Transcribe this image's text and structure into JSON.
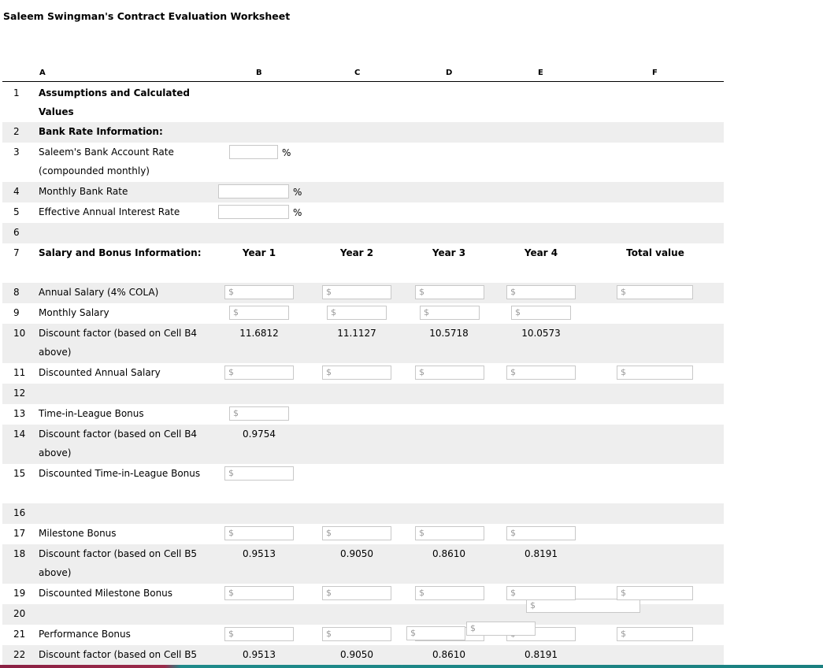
{
  "title": "Saleem Swingman's Contract Evaluation Worksheet",
  "columns": [
    "A",
    "B",
    "C",
    "D",
    "E",
    "F"
  ],
  "currency_placeholder": "$",
  "percent_sign": "%",
  "rows": {
    "r1": "Assumptions and Calculated Values",
    "r2": "Bank Rate Information:",
    "r3": "Saleem's Bank Account Rate (compounded monthly)",
    "r4": "Monthly Bank Rate",
    "r5": "Effective Annual Interest Rate",
    "r7": "Salary and Bonus Information:",
    "r8": "Annual Salary (4% COLA)",
    "r9": "Monthly Salary",
    "r10": "Discount factor (based on Cell B4 above)",
    "r11": "Discounted Annual Salary",
    "r13": "Time-in-League Bonus",
    "r14": "Discount factor (based on Cell B4 above)",
    "r15": "Discounted Time-in-League Bonus",
    "r17": "Milestone Bonus",
    "r18": "Discount factor (based on Cell B5 above)",
    "r19": "Discounted Milestone Bonus",
    "r21": "Performance Bonus",
    "r22": "Discount factor (based on Cell B5"
  },
  "year_headers": [
    "Year 1",
    "Year 2",
    "Year 3",
    "Year 4",
    "Total value"
  ],
  "values": {
    "r10": [
      "11.6812",
      "11.1127",
      "10.5718",
      "10.0573"
    ],
    "r14": [
      "0.9754"
    ],
    "r18": [
      "0.9513",
      "0.9050",
      "0.8610",
      "0.8191"
    ],
    "r22": [
      "0.9513",
      "0.9050",
      "0.8610",
      "0.8191"
    ]
  },
  "row_numbers": [
    "1",
    "2",
    "3",
    "4",
    "5",
    "6",
    "7",
    "8",
    "9",
    "10",
    "11",
    "12",
    "13",
    "14",
    "15",
    "16",
    "17",
    "18",
    "19",
    "20",
    "21",
    "22"
  ]
}
